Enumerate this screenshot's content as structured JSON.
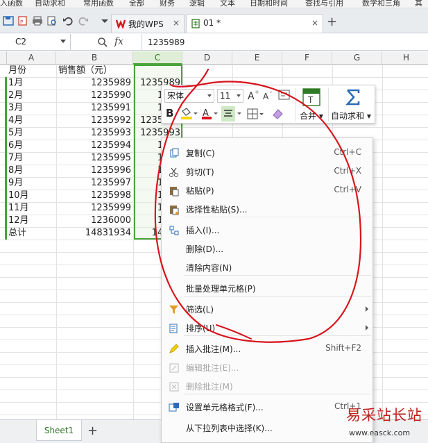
{
  "ribbon": [
    "入函数",
    "自动求和",
    "常用函数",
    "全部",
    "财务",
    "逻辑",
    "文本",
    "日期和时间",
    "查找与引用",
    "数学和三角",
    "其"
  ],
  "tabs": [
    {
      "label": "我的WPS",
      "close": "×"
    },
    {
      "label": "01 *",
      "close": "×"
    }
  ],
  "new_tab": "+",
  "formula_bar": {
    "name_box": "C2",
    "fx": "fx",
    "value": "1235989"
  },
  "columns": [
    "A",
    "B",
    "C",
    "D",
    "E",
    "F",
    "G",
    "H"
  ],
  "rows": [
    {
      "a": "月份",
      "b": "销售额（元）",
      "c": ""
    },
    {
      "a": "1月",
      "b": "1235989",
      "c": "1235989"
    },
    {
      "a": "2月",
      "b": "1235990",
      "c": "1235"
    },
    {
      "a": "3月",
      "b": "1235991",
      "c": "1235"
    },
    {
      "a": "4月",
      "b": "1235992",
      "c": "1235992"
    },
    {
      "a": "5月",
      "b": "1235993",
      "c": "1235993"
    },
    {
      "a": "6月",
      "b": "1235994",
      "c": "1235"
    },
    {
      "a": "7月",
      "b": "1235995",
      "c": "1235"
    },
    {
      "a": "8月",
      "b": "1235996",
      "c": "1235"
    },
    {
      "a": "9月",
      "b": "1235997",
      "c": "1235"
    },
    {
      "a": "10月",
      "b": "1235998",
      "c": "1235"
    },
    {
      "a": "11月",
      "b": "1235999",
      "c": "1235"
    },
    {
      "a": "12月",
      "b": "1236000",
      "c": "1236"
    },
    {
      "a": "总计",
      "b": "14831934",
      "c": "14831"
    }
  ],
  "mini_toolbar": {
    "font_name": "宋体",
    "font_size": "11",
    "merge_label": "合并",
    "autosum_label": "自动求和"
  },
  "context_menu": [
    {
      "label": "复制(C)",
      "shortcut": "Ctrl+C",
      "icon": "copy-icon",
      "disabled": false,
      "submenu": false
    },
    {
      "label": "剪切(T)",
      "shortcut": "Ctrl+X",
      "icon": "scissors-icon",
      "disabled": false,
      "submenu": false
    },
    {
      "label": "粘贴(P)",
      "shortcut": "Ctrl+V",
      "icon": "paste-icon",
      "disabled": false,
      "submenu": false
    },
    {
      "label": "选择性粘贴(S)...",
      "shortcut": "",
      "icon": "paste-special-icon",
      "disabled": false,
      "submenu": false
    },
    {
      "label": "插入(I)...",
      "shortcut": "",
      "icon": "insert-icon",
      "disabled": false,
      "submenu": false
    },
    {
      "label": "删除(D)...",
      "shortcut": "",
      "icon": "",
      "disabled": false,
      "submenu": false
    },
    {
      "label": "清除内容(N)",
      "shortcut": "",
      "icon": "",
      "disabled": false,
      "submenu": false
    },
    {
      "label": "批量处理单元格(P)",
      "shortcut": "",
      "icon": "",
      "disabled": false,
      "submenu": false
    },
    {
      "label": "筛选(L)",
      "shortcut": "",
      "icon": "filter-icon",
      "disabled": false,
      "submenu": true
    },
    {
      "label": "排序(U)",
      "shortcut": "",
      "icon": "sort-icon",
      "disabled": false,
      "submenu": true
    },
    {
      "label": "插入批注(M)...",
      "shortcut": "Shift+F2",
      "icon": "add-comment-icon",
      "disabled": false,
      "submenu": false
    },
    {
      "label": "编辑批注(E)...",
      "shortcut": "",
      "icon": "edit-comment-icon",
      "disabled": true,
      "submenu": false
    },
    {
      "label": "删除批注(M)",
      "shortcut": "",
      "icon": "delete-comment-icon",
      "disabled": true,
      "submenu": false
    },
    {
      "label": "设置单元格格式(F)...",
      "shortcut": "Ctrl+1",
      "icon": "format-cells-icon",
      "disabled": false,
      "submenu": false
    },
    {
      "label": "从下拉列表中选择(K)...",
      "shortcut": "",
      "icon": "",
      "disabled": false,
      "submenu": false
    }
  ],
  "sheet_tab": "Sheet1",
  "add_sheet": "+",
  "watermark": {
    "cn": "易采站长站",
    "en": "www.easck.com"
  },
  "colors": {
    "accent_green": "#4aa23c",
    "annotation_red": "#d8141c"
  }
}
